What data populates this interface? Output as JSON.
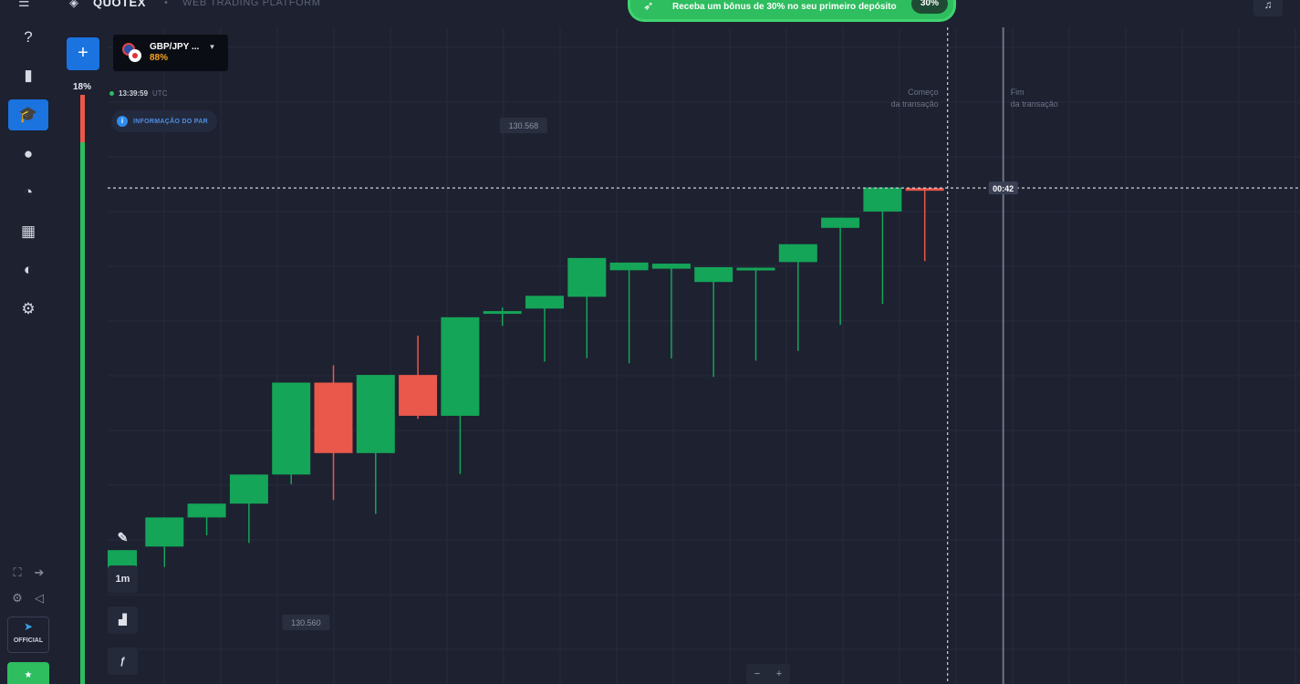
{
  "header": {
    "logo_text": "QUOTEX",
    "separator": "•",
    "subtitle": "WEB TRADING PLATFORM",
    "menu_icon": "hamburger-icon",
    "promo": {
      "icon": "rocket-icon",
      "text": "Receba um bônus de 30% no seu primeiro depósito",
      "badge": "30%",
      "color": "#2ebd5f"
    },
    "bell_icon": "bell-icon"
  },
  "sidebar": {
    "items": [
      {
        "name": "support",
        "icon": "?"
      },
      {
        "name": "analytics",
        "icon": "▮"
      },
      {
        "name": "education",
        "icon": "🎓",
        "active": true
      },
      {
        "name": "account",
        "icon": "●"
      },
      {
        "name": "tournaments",
        "icon": "◔"
      },
      {
        "name": "market",
        "icon": "▦"
      },
      {
        "name": "achievements",
        "icon": "◐"
      },
      {
        "name": "settings",
        "icon": "⚙"
      }
    ],
    "telegram_label": "OFFICIAL",
    "telegram_icon": "telegram-icon"
  },
  "trade_panel": {
    "add_label": "+",
    "sentiment_label": "18%",
    "sentiment_red_fraction": 0.08
  },
  "asset": {
    "name": "GBP/JPY ...",
    "payout": "88%",
    "caret": "▾"
  },
  "clock": {
    "time": "13:39:59",
    "timezone": "UTC"
  },
  "pair_info": {
    "label": "INFORMAÇÃO DO PAR",
    "icon": "i"
  },
  "tools": {
    "draw_icon": "✎",
    "timeframe": "1m",
    "chart_type_icon": "▟",
    "indicators_icon": "ƒ"
  },
  "zoom": {
    "minus": "−",
    "plus": "+"
  },
  "colors": {
    "background": "#1d2130",
    "up": "#14a558",
    "down": "#e9584b",
    "accent": "#1b73e0"
  },
  "chart_data": {
    "type": "candlestick",
    "current_price_label": "00:42",
    "high_label": "130.568",
    "low_label": "130.560",
    "markers": [
      {
        "label": "Começo\nda transação"
      },
      {
        "label": "Fim\nda transação"
      }
    ],
    "candles": [
      {
        "o": 10.0,
        "h": 12.5,
        "l": 9.8,
        "c": 15.5
      },
      {
        "o": 16.2,
        "h": 12.2,
        "l": 18.5,
        "c": 21.9
      },
      {
        "o": 21.9,
        "h": 21.8,
        "l": 18.4,
        "c": 24.6
      },
      {
        "o": 24.6,
        "h": 16.9,
        "l": 25.0,
        "c": 30.3
      },
      {
        "o": 30.3,
        "h": 28.4,
        "l": 30.7,
        "c": 48.3
      },
      {
        "o": 48.3,
        "h": 25.3,
        "l": 51.7,
        "c": 34.5
      },
      {
        "o": 34.5,
        "h": 22.6,
        "l": 34.2,
        "c": 49.8
      },
      {
        "o": 49.8,
        "h": 41.2,
        "l": 57.5,
        "c": 41.8
      },
      {
        "o": 41.8,
        "h": 30.4,
        "l": 41.9,
        "c": 61.1
      },
      {
        "o": 62.1,
        "h": 59.4,
        "l": 63.0,
        "c": 62.3
      },
      {
        "o": 62.8,
        "h": 61.3,
        "l": 52.4,
        "c": 65.3
      },
      {
        "o": 65.1,
        "h": 53.1,
        "l": 63.5,
        "c": 72.7
      },
      {
        "o": 70.3,
        "h": 52.1,
        "l": 63.3,
        "c": 71.8
      },
      {
        "o": 70.6,
        "h": 53.0,
        "l": 61.9,
        "c": 71.6
      },
      {
        "o": 68.0,
        "h": 49.4,
        "l": 60.9,
        "c": 70.9
      },
      {
        "o": 70.7,
        "h": 52.6,
        "l": 63.0,
        "c": 70.8
      },
      {
        "o": 71.9,
        "h": 54.5,
        "l": 62.6,
        "c": 75.4
      },
      {
        "o": 78.6,
        "h": 59.6,
        "l": 76.5,
        "c": 80.6
      },
      {
        "o": 81.8,
        "h": 63.7,
        "l": 75.7,
        "c": 86.5
      },
      {
        "o": 86.4,
        "h": 72.1,
        "l": 78.9,
        "c": 85.9
      }
    ]
  }
}
